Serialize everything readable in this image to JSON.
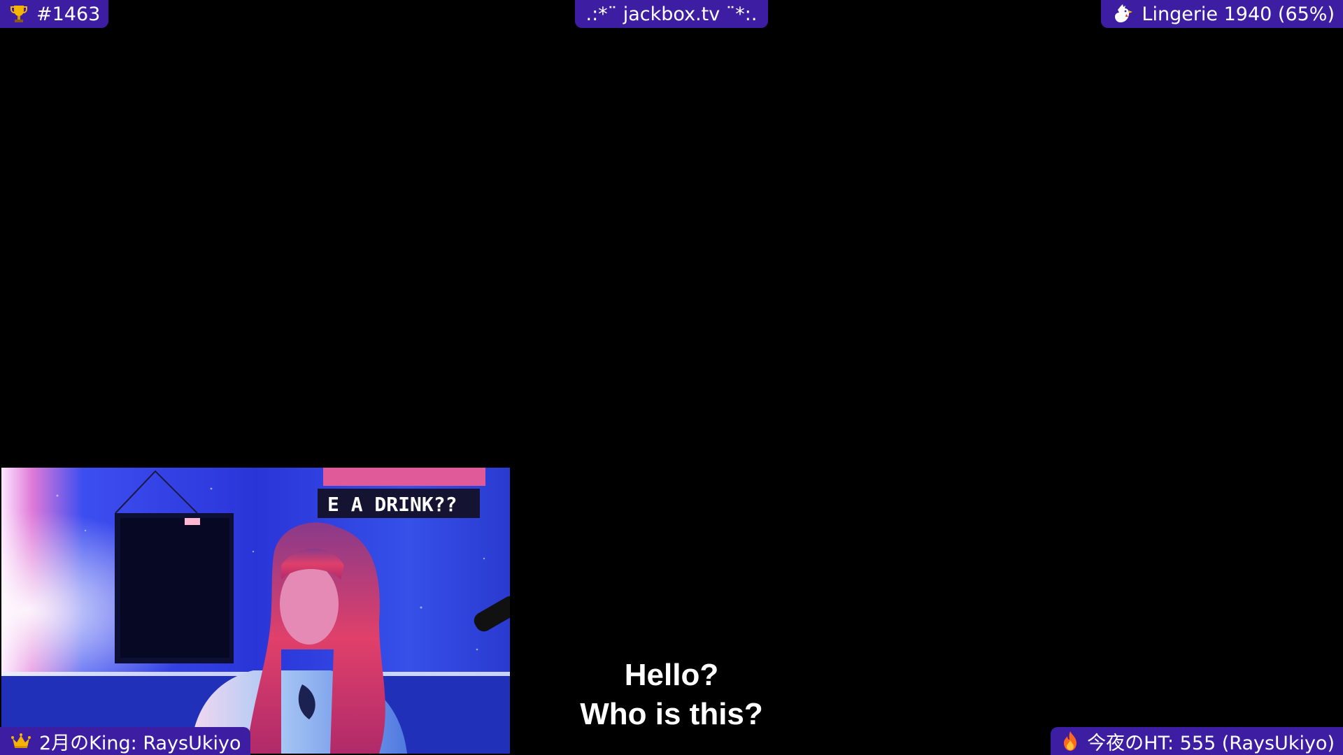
{
  "overlay": {
    "top_left": {
      "icon": "trophy-icon",
      "text": "#1463"
    },
    "top_center": {
      "text": ".:*¨ jackbox.tv ¨*:."
    },
    "top_right": {
      "icon": "rooster-icon",
      "text": "Lingerie 1940 (65%)"
    },
    "bottom_left": {
      "icon": "crown-icon",
      "text": "2月のKing:  RaysUkiyo"
    },
    "bottom_right": {
      "icon": "fire-icon",
      "text": "今夜のHT:  555 (RaysUkiyo)"
    }
  },
  "webcam": {
    "sign_text": "E A DRINK??"
  },
  "caption": {
    "line1": "Hello?",
    "line2": "Who is this?"
  },
  "colors": {
    "pill_background": "#3d1ea3",
    "background": "#000000",
    "caption_text": "#ffffff"
  }
}
